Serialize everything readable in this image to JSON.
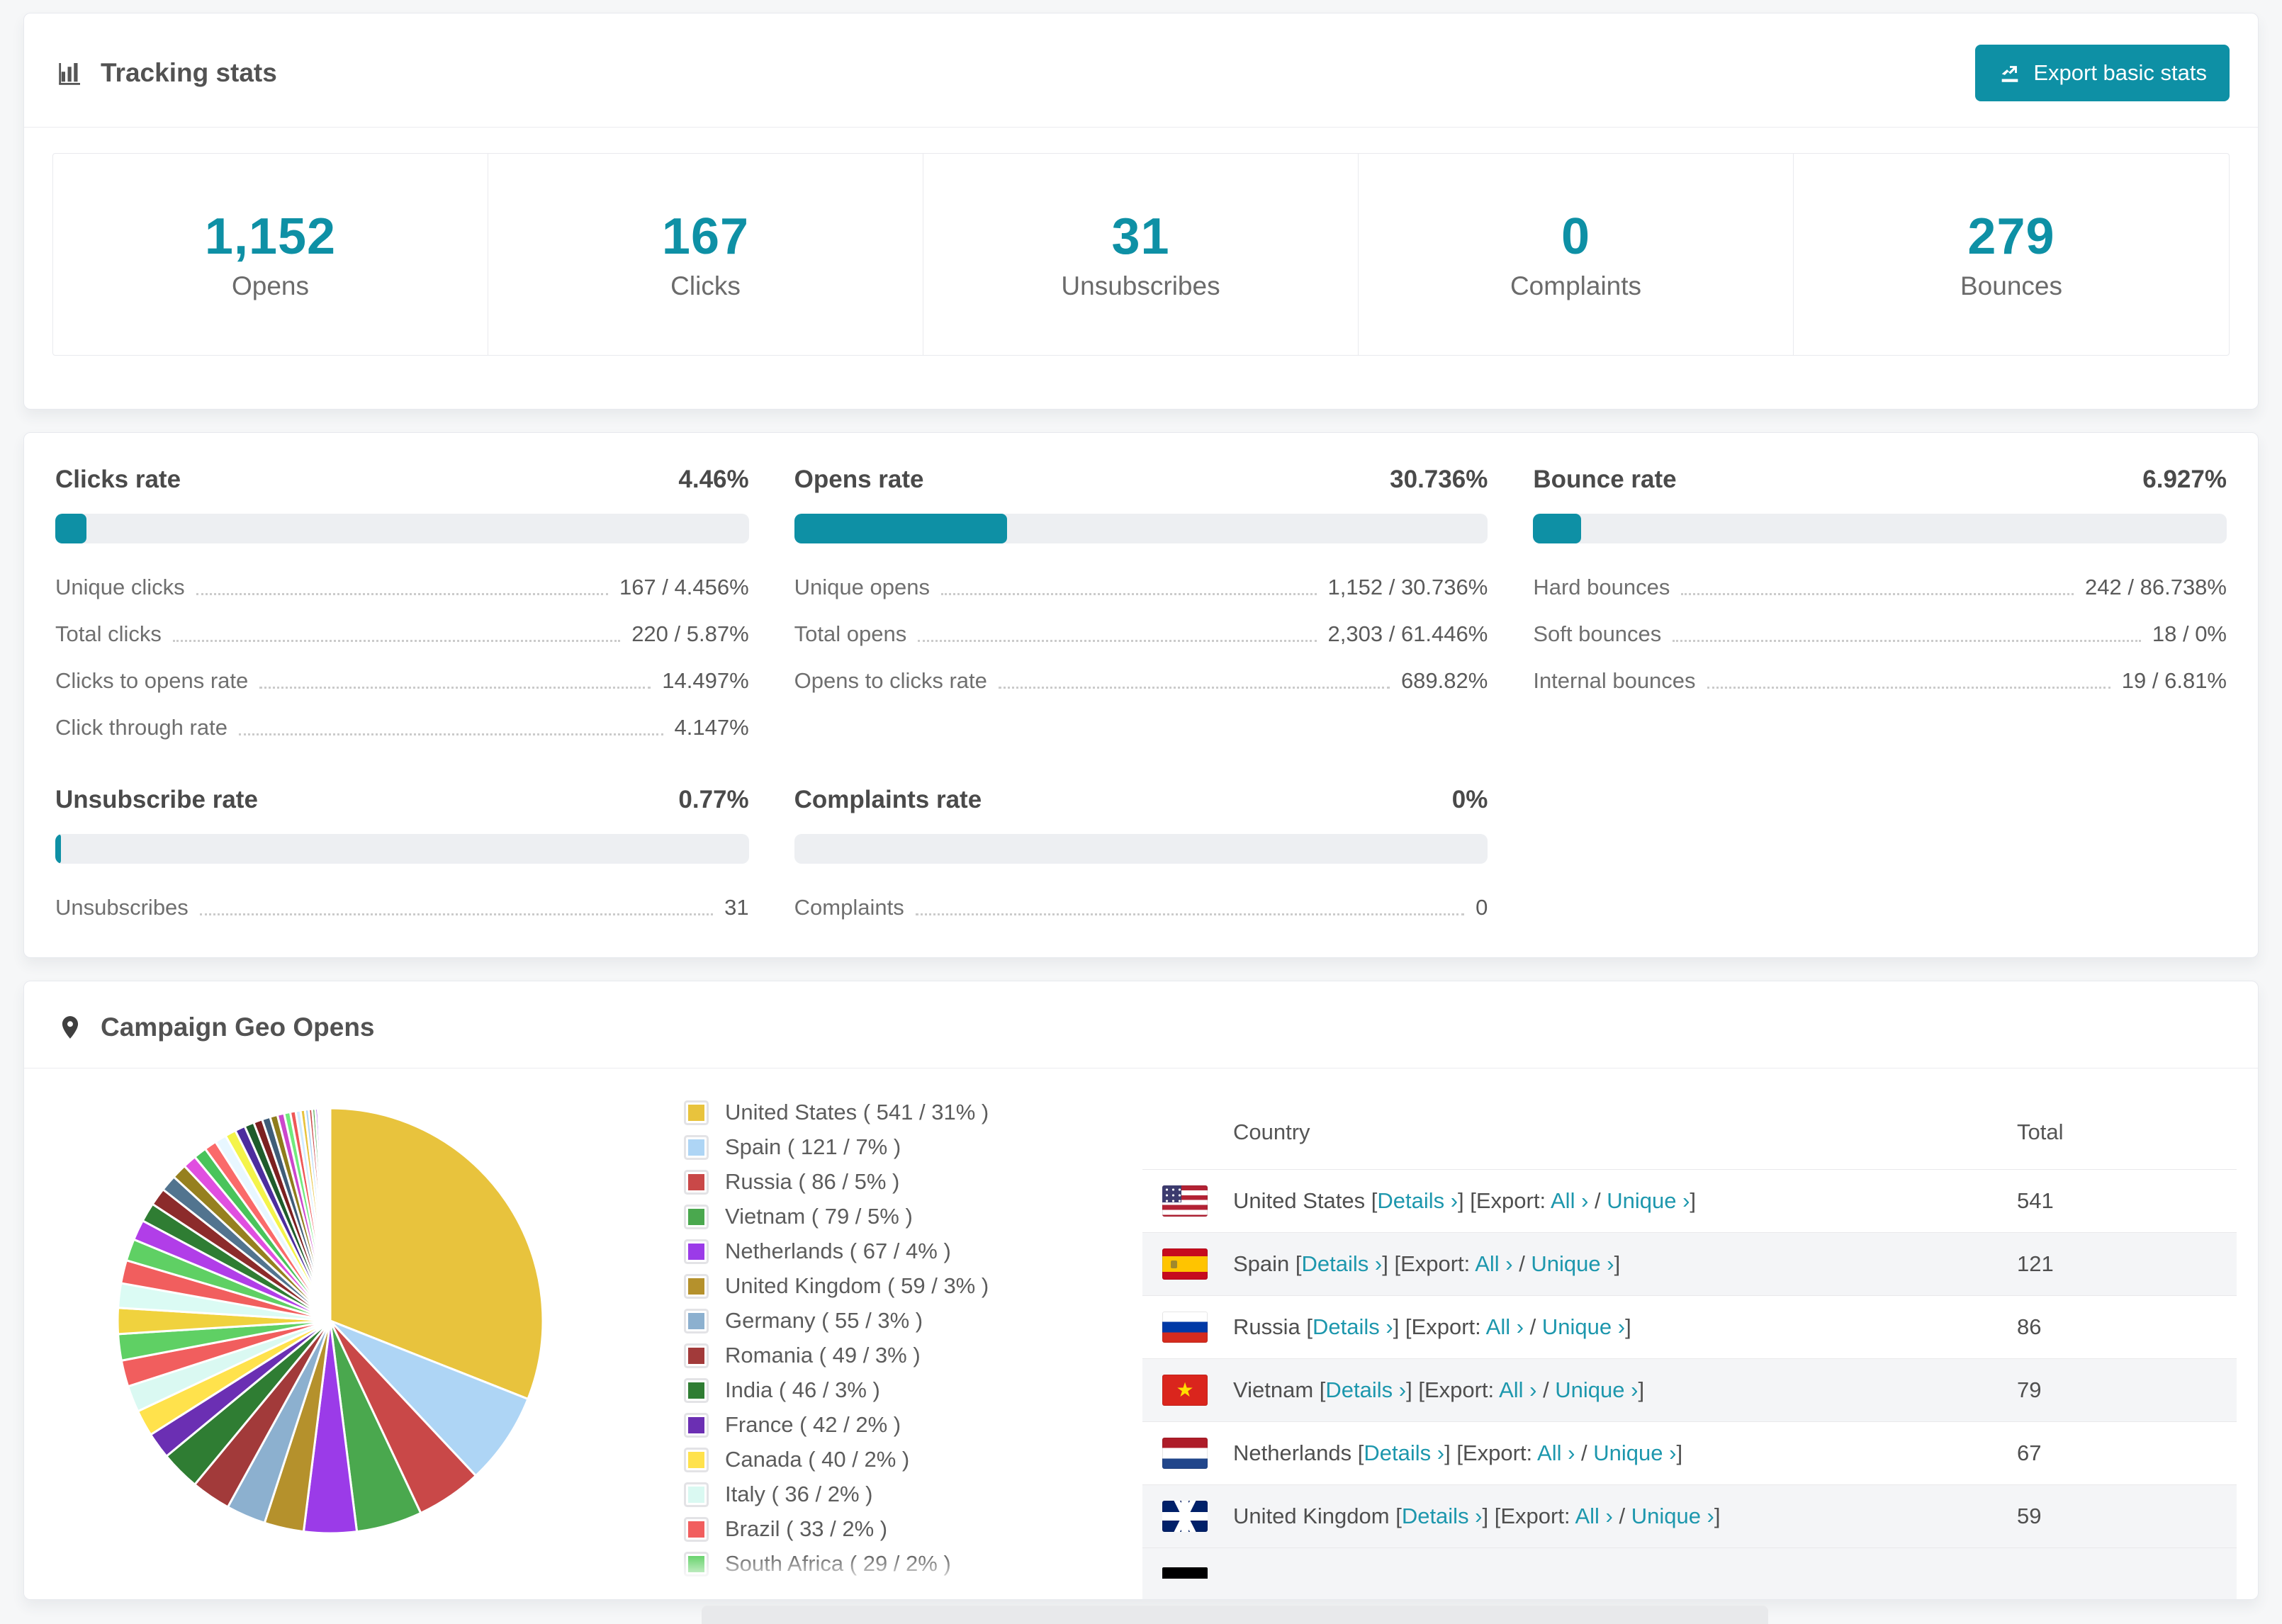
{
  "accent": "#0e90a5",
  "tracking": {
    "title": "Tracking stats",
    "export_button": "Export basic stats",
    "cards": [
      {
        "value": "1,152",
        "label": "Opens"
      },
      {
        "value": "167",
        "label": "Clicks"
      },
      {
        "value": "31",
        "label": "Unsubscribes"
      },
      {
        "value": "0",
        "label": "Complaints"
      },
      {
        "value": "279",
        "label": "Bounces"
      }
    ]
  },
  "rates": {
    "blocks": [
      {
        "title": "Clicks rate",
        "value": "4.46%",
        "fill_pct": 4.46,
        "rows": [
          {
            "label": "Unique clicks",
            "value": "167 / 4.456%"
          },
          {
            "label": "Total clicks",
            "value": "220 / 5.87%"
          },
          {
            "label": "Clicks to opens rate",
            "value": "14.497%"
          },
          {
            "label": "Click through rate",
            "value": "4.147%"
          }
        ]
      },
      {
        "title": "Opens rate",
        "value": "30.736%",
        "fill_pct": 30.736,
        "rows": [
          {
            "label": "Unique opens",
            "value": "1,152 / 30.736%"
          },
          {
            "label": "Total opens",
            "value": "2,303 / 61.446%"
          },
          {
            "label": "Opens to clicks rate",
            "value": "689.82%"
          }
        ]
      },
      {
        "title": "Bounce rate",
        "value": "6.927%",
        "fill_pct": 6.927,
        "rows": [
          {
            "label": "Hard bounces",
            "value": "242 / 86.738%"
          },
          {
            "label": "Soft bounces",
            "value": "18 / 0%"
          },
          {
            "label": "Internal bounces",
            "value": "19 / 6.81%"
          }
        ]
      },
      {
        "title": "Unsubscribe rate",
        "value": "0.77%",
        "fill_pct": 0.77,
        "rows": [
          {
            "label": "Unsubscribes",
            "value": "31"
          }
        ]
      },
      {
        "title": "Complaints rate",
        "value": "0%",
        "fill_pct": 0,
        "rows": [
          {
            "label": "Complaints",
            "value": "0"
          }
        ]
      }
    ]
  },
  "geo": {
    "title": "Campaign Geo Opens",
    "legend": [
      {
        "label": "United States ( 541 / 31% )",
        "color": "#e8c33d"
      },
      {
        "label": "Spain ( 121 / 7% )",
        "color": "#aed5f5"
      },
      {
        "label": "Russia ( 86 / 5% )",
        "color": "#c94848"
      },
      {
        "label": "Vietnam ( 79 / 5% )",
        "color": "#4aa84e"
      },
      {
        "label": "Netherlands ( 67 / 4% )",
        "color": "#9b3be8"
      },
      {
        "label": "United Kingdom ( 59 / 3% )",
        "color": "#b5912c"
      },
      {
        "label": "Germany ( 55 / 3% )",
        "color": "#8cb0cf"
      },
      {
        "label": "Romania ( 49 / 3% )",
        "color": "#a23a3a"
      },
      {
        "label": "India ( 46 / 3% )",
        "color": "#2f7d33"
      },
      {
        "label": "France ( 42 / 2% )",
        "color": "#6b2fb3"
      },
      {
        "label": "Canada ( 40 / 2% )",
        "color": "#ffe24c"
      },
      {
        "label": "Italy ( 36 / 2% )",
        "color": "#daf9f2"
      },
      {
        "label": "Brazil ( 33 / 2% )",
        "color": "#f15e5e"
      },
      {
        "label": "South Africa ( 29 / 2% )",
        "color": "#5fd064"
      }
    ],
    "table": {
      "headers": {
        "country": "Country",
        "total": "Total"
      },
      "links": {
        "p1": " [",
        "details": "Details ›",
        "p2": "] [Export: ",
        "all": "All ›",
        "p3": " / ",
        "unique": "Unique ›",
        "p4": "]"
      },
      "rows": [
        {
          "flag": "us",
          "name": "United States",
          "total": "541"
        },
        {
          "flag": "es",
          "name": "Spain",
          "total": "121"
        },
        {
          "flag": "ru",
          "name": "Russia",
          "total": "86"
        },
        {
          "flag": "vn",
          "name": "Vietnam",
          "total": "79"
        },
        {
          "flag": "nl",
          "name": "Netherlands",
          "total": "67"
        },
        {
          "flag": "gb",
          "name": "United Kingdom",
          "total": "59"
        }
      ],
      "partial_row_flag": "de"
    }
  },
  "chart_data": {
    "type": "pie",
    "title": "Campaign Geo Opens",
    "unit": "opens",
    "start_angle": "12 o'clock",
    "direction": "clockwise",
    "legend_position": "right",
    "items": [
      {
        "label": "United States",
        "value": 541,
        "pct": 31,
        "color": "#e8c33d"
      },
      {
        "label": "Spain",
        "value": 121,
        "pct": 7,
        "color": "#aed5f5"
      },
      {
        "label": "Russia",
        "value": 86,
        "pct": 5,
        "color": "#c94848"
      },
      {
        "label": "Vietnam",
        "value": 79,
        "pct": 5,
        "color": "#4aa84e"
      },
      {
        "label": "Netherlands",
        "value": 67,
        "pct": 4,
        "color": "#9b3be8"
      },
      {
        "label": "United Kingdom",
        "value": 59,
        "pct": 3,
        "color": "#b5912c"
      },
      {
        "label": "Germany",
        "value": 55,
        "pct": 3,
        "color": "#8cb0cf"
      },
      {
        "label": "Romania",
        "value": 49,
        "pct": 3,
        "color": "#a23a3a"
      },
      {
        "label": "India",
        "value": 46,
        "pct": 3,
        "color": "#2f7d33"
      },
      {
        "label": "France",
        "value": 42,
        "pct": 2,
        "color": "#6b2fb3"
      },
      {
        "label": "Canada",
        "value": 40,
        "pct": 2,
        "color": "#ffe24c"
      },
      {
        "label": "Italy",
        "value": 36,
        "pct": 2,
        "color": "#daf9f2"
      },
      {
        "label": "Brazil",
        "value": 33,
        "pct": 2,
        "color": "#f15e5e"
      },
      {
        "label": "South Africa",
        "value": 29,
        "pct": 2,
        "color": "#5fd064"
      }
    ],
    "other": {
      "note": "long tail of smaller countries, unlabeled in legend",
      "total_pct_approx": 26,
      "tail_pcts": [
        1.9,
        1.8,
        1.7,
        1.6,
        1.5,
        1.4,
        1.3,
        1.2,
        1.1,
        1.0,
        0.95,
        0.9,
        0.85,
        0.8,
        0.75,
        0.7,
        0.65,
        0.6,
        0.55,
        0.5,
        0.45,
        0.4,
        0.36,
        0.32,
        0.28,
        0.25,
        0.22,
        0.19,
        0.16,
        0.14,
        0.12,
        0.1,
        0.08,
        0.07,
        0.06,
        0.05,
        0.04,
        0.03,
        0.03,
        0.02
      ],
      "tail_colors": [
        "#f0d23e",
        "#dbfbf4",
        "#f15e5e",
        "#5fd064",
        "#b13ee8",
        "#2f7d33",
        "#8c2b2b",
        "#52748f",
        "#96801f",
        "#e04fe0",
        "#49c45b",
        "#fa6a6a",
        "#e8f7ff",
        "#f4f44a",
        "#4d2d9e",
        "#1e5c2b",
        "#7c2020",
        "#3f5d78",
        "#8f7c1c",
        "#cc46cc",
        "#71ea7d",
        "#ee5757",
        "#d2ecff",
        "#e8c33d",
        "#aed5f5",
        "#c94848",
        "#4aa84e",
        "#9b3be8",
        "#b5912c",
        "#8cb0cf",
        "#a23a3a",
        "#2f7d33",
        "#6b2fb3",
        "#ffe24c",
        "#dbfbf4",
        "#f15e5e",
        "#5fd064",
        "#e8c33d",
        "#aed5f5",
        "#c94848"
      ]
    }
  }
}
